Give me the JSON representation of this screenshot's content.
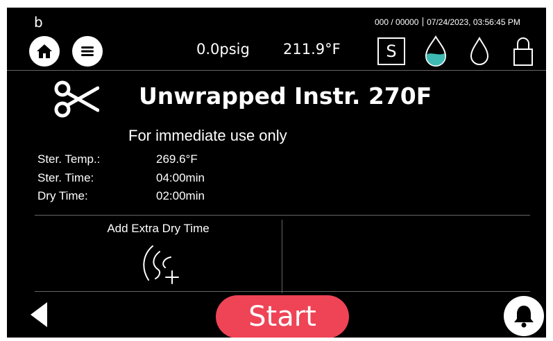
{
  "header": {
    "corner_label": "b",
    "cycle_counter": "000 / 00000",
    "datetime": "07/24/2023, 03:56:45 PM",
    "pressure": "0.0psig",
    "temperature": "211.9°F",
    "standby_badge": "S"
  },
  "icons": {
    "home": "home-icon",
    "menu": "menu-icon",
    "water_reservoir_partial": "water-drop-icon",
    "water_empty": "water-drop-outline-icon",
    "lock": "lock-icon",
    "program": "scissors-icon",
    "dry": "dry-time-add-icon",
    "back": "back-arrow-icon",
    "alarm": "bell-icon"
  },
  "program": {
    "title": "Unwrapped Instr. 270F",
    "subtitle": "For immediate use only",
    "params": [
      {
        "label": "Ster. Temp.:",
        "value": "269.6°F"
      },
      {
        "label": "Ster. Time:",
        "value": "04:00min"
      },
      {
        "label": "Dry Time:",
        "value": "02:00min"
      }
    ]
  },
  "options": {
    "extra_dry_label": "Add Extra Dry Time"
  },
  "footer": {
    "start_label": "Start"
  },
  "colors": {
    "start_button": "#ee4456",
    "water_fill": "#3fb9b3",
    "background": "#000000"
  }
}
